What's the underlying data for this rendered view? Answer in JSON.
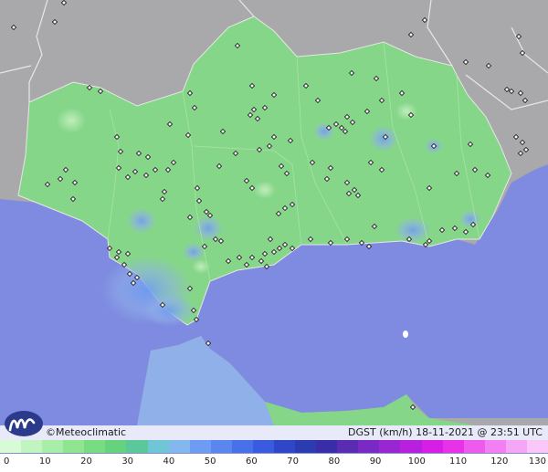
{
  "map": {
    "brand": "©Meteoclimatic",
    "caption": "DGST (km/h)  18-11-2021 @ 23:51 UTC",
    "colors": {
      "sea": "#7e8be0",
      "land_outside": "#a9a9ab",
      "region": "#86d68a",
      "gust_high": "#8fb0e8"
    },
    "icons": [
      "meteoclimatic-logo-icon",
      "station-marker-icon"
    ]
  },
  "legend": {
    "unit": "km/h",
    "tick_labels": [
      "0",
      "10",
      "20",
      "30",
      "40",
      "50",
      "60",
      "70",
      "80",
      "90",
      "100",
      "110",
      "120",
      "130"
    ],
    "colors": [
      "#d6fbd6",
      "#c0f4c0",
      "#a8eea8",
      "#90e690",
      "#78dc80",
      "#66d27e",
      "#5ac89a",
      "#6fc6d6",
      "#82b8ee",
      "#6e9cf2",
      "#5a86f0",
      "#4870e8",
      "#3a5ae0",
      "#3046c8",
      "#2a3cb0",
      "#3a2ea8",
      "#5a2cb4",
      "#7a2ac4",
      "#9a26d2",
      "#b820e0",
      "#d61ee6",
      "#e832e8",
      "#ee5aee",
      "#f280f2",
      "#f6a6f6",
      "#f9c8f9"
    ]
  }
}
